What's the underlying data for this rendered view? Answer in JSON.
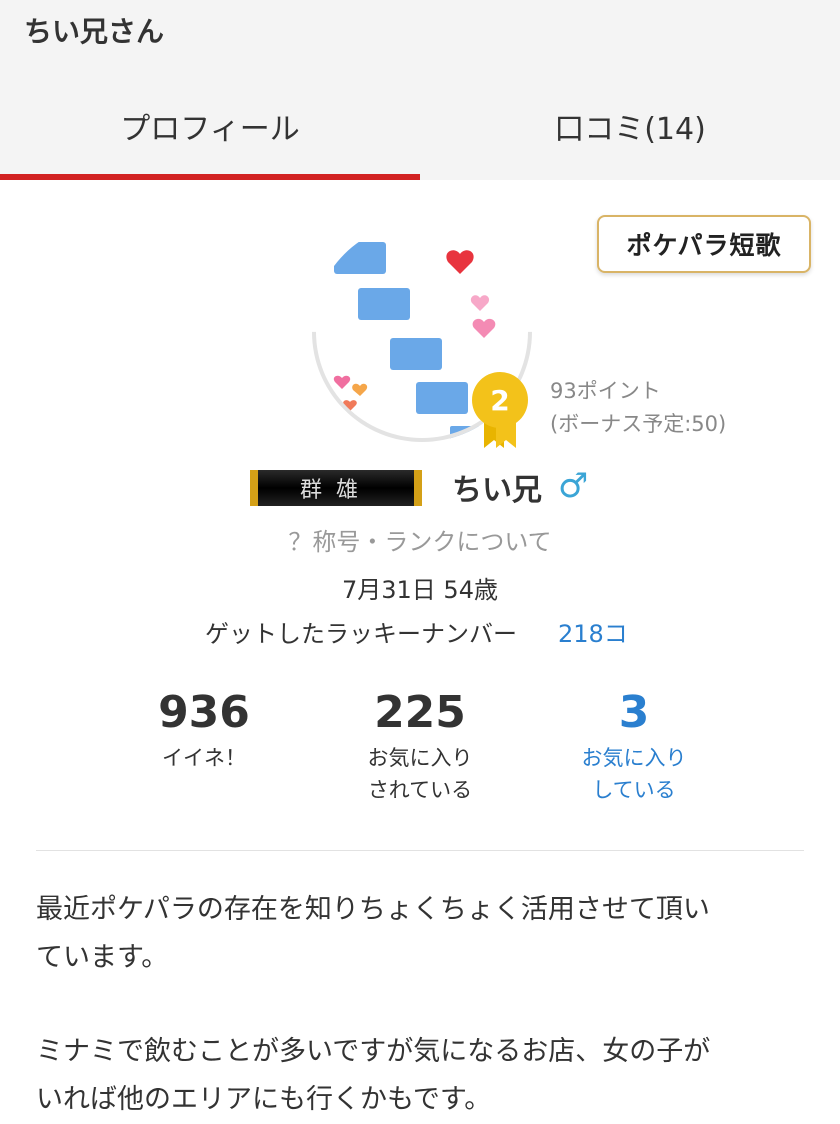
{
  "header": {
    "title": "ちい兄さん"
  },
  "tabs": [
    {
      "label": "プロフィール",
      "active": true
    },
    {
      "label": "口コミ(14)",
      "active": false
    }
  ],
  "colors": {
    "accent_red": "#d22222",
    "link_blue": "#2a7fcf",
    "gold": "#f3c21a",
    "gender_blue": "#3ba5d6"
  },
  "tanka_button": {
    "label": "ポケパラ短歌"
  },
  "profile": {
    "rank": "2",
    "points": "93ポイント",
    "bonus": "(ボーナス予定:50)",
    "title_plate": "群雄",
    "name": "ちい兄",
    "gender_symbol": "♂",
    "rank_link": "？称号・ランクについて",
    "birthday": "7月31日 54歳",
    "lucky_label": "ゲットしたラッキーナンバー",
    "lucky_count": "218コ"
  },
  "stats": [
    {
      "value": "936",
      "label_line1": "イイネ！",
      "label_line2": ""
    },
    {
      "value": "225",
      "label_line1": "お気に入り",
      "label_line2": "されている"
    },
    {
      "value": "3",
      "label_line1": "お気に入り",
      "label_line2": "している"
    }
  ],
  "bio": {
    "paragraph1_line1": "最近ポケパラの存在を知りちょくちょく活用させて頂い",
    "paragraph1_line2": "ています。",
    "paragraph2_line1": "ミナミで飲むことが多いですが気になるお店、女の子が",
    "paragraph2_line2": "いれば他のエリアにも行くかもです。"
  }
}
